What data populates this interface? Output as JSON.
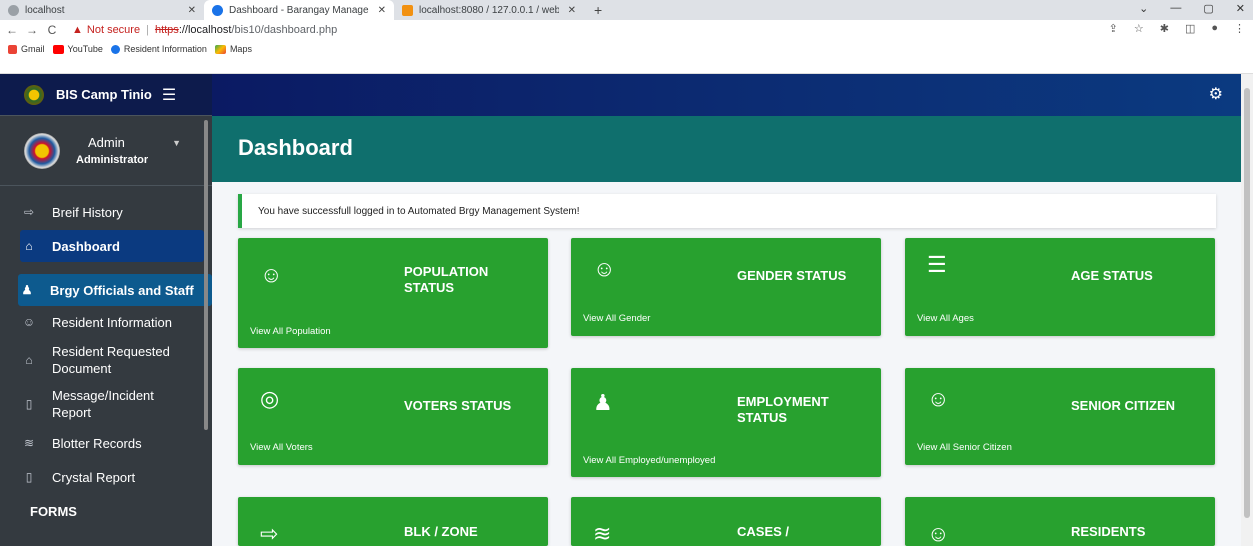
{
  "browser": {
    "tabs": [
      {
        "label": "localhost",
        "active": false
      },
      {
        "label": "Dashboard - Barangay Managem",
        "active": true
      },
      {
        "label": "localhost:8080 / 127.0.0.1 / web",
        "active": false
      }
    ],
    "new_tab": "+",
    "not_secure": "Not secure",
    "url_proto": "https",
    "url_host": "://localhost",
    "url_path": "/bis10/dashboard.php",
    "bookmarks": [
      "Gmail",
      "YouTube",
      "Resident Information",
      "Maps"
    ]
  },
  "sidebar": {
    "brand": "BIS Camp Tinio",
    "user": {
      "name": "Admin",
      "role": "Administrator"
    },
    "items": [
      {
        "label": "Breif History",
        "icon": "signpost-icon"
      },
      {
        "label": "Dashboard",
        "icon": "home-icon",
        "active": true
      },
      {
        "label": "Brgy Officials and Staff",
        "icon": "user-tie-icon",
        "hover": true
      },
      {
        "label": "Resident Information",
        "icon": "users-icon"
      },
      {
        "label": "Resident Requested Document",
        "icon": "home-icon"
      },
      {
        "label": "Message/Incident Report",
        "icon": "file-icon"
      },
      {
        "label": "Blotter Records",
        "icon": "layers-icon"
      },
      {
        "label": "Crystal Report",
        "icon": "file-icon"
      }
    ],
    "section_forms": "FORMS"
  },
  "main": {
    "page_title": "Dashboard",
    "alert": "You have successfull logged in to Automated Brgy Management System!",
    "cards": [
      {
        "title": "POPULATION STATUS",
        "link": "View All Population",
        "icon": "users-icon"
      },
      {
        "title": "GENDER STATUS",
        "link": "View All Gender",
        "icon": "users-icon"
      },
      {
        "title": "AGE STATUS",
        "link": "View All Ages",
        "icon": "list-icon"
      },
      {
        "title": "VOTERS STATUS",
        "link": "View All Voters",
        "icon": "fingerprint-icon"
      },
      {
        "title": "EMPLOYMENT STATUS",
        "link": "View All Employed/unemployed",
        "icon": "user-tie-icon"
      },
      {
        "title": "SENIOR CITIZEN",
        "link": "View All Senior Citizen",
        "icon": "users-icon"
      },
      {
        "title": "BLK / ZONE",
        "link": "",
        "icon": "signpost-icon"
      },
      {
        "title": "CASES /",
        "link": "",
        "icon": "layers-icon"
      },
      {
        "title": "RESIDENTS",
        "link": "",
        "icon": "users-icon"
      }
    ]
  },
  "colors": {
    "card_green": "#28a12f",
    "header_navy": "#0b1a63",
    "content_teal": "#0f6f6d",
    "sidebar_dark": "#343a40"
  }
}
